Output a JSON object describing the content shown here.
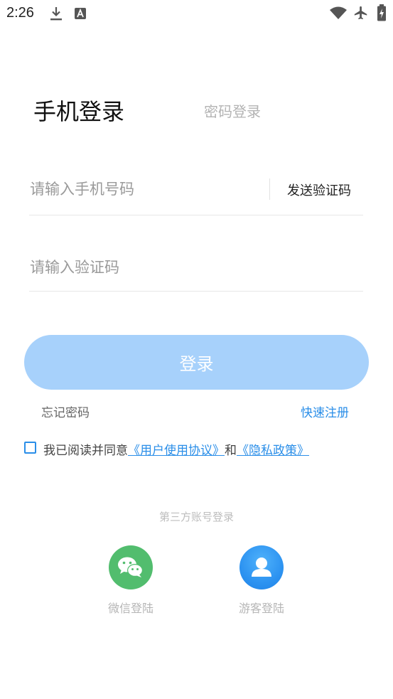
{
  "status_bar": {
    "time": "2:26",
    "icons": [
      "download-icon",
      "font-a-icon",
      "wifi-icon",
      "airplane-icon",
      "battery-charging-icon"
    ]
  },
  "tabs": {
    "active": "手机登录",
    "inactive": "密码登录"
  },
  "form": {
    "phone_placeholder": "请输入手机号码",
    "phone_value": "",
    "send_code_label": "发送验证码",
    "code_placeholder": "请输入验证码",
    "code_value": ""
  },
  "login_button": {
    "label": "登录"
  },
  "links": {
    "forgot_password": "忘记密码",
    "quick_register": "快速注册"
  },
  "agreement": {
    "prefix": "我已阅读并同意",
    "user_agreement": "《用户使用协议》",
    "and": "和",
    "privacy_policy": "《隐私政策》",
    "checked": false
  },
  "third_party": {
    "title": "第三方账号登录",
    "wechat_label": "微信登陆",
    "guest_label": "游客登陆"
  },
  "colors": {
    "accent": "#2a8ee8",
    "login_button_bg": "#a7d1fb",
    "wechat_green": "#52bd6e",
    "guest_blue": "#2d93f1",
    "placeholder_gray": "#9a9a9a"
  }
}
